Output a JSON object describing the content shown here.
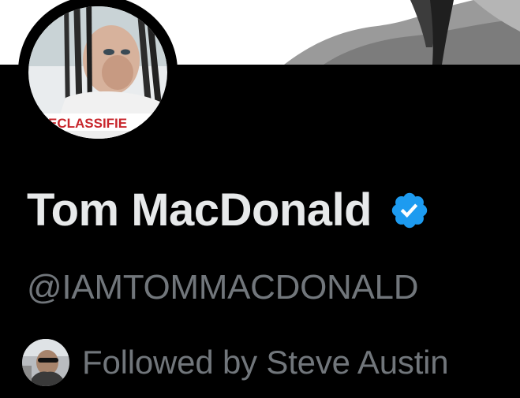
{
  "profile": {
    "display_name": "Tom MacDonald",
    "handle": "@IAMTOMMACDONALD",
    "verified": true,
    "avatar_label": "ECLASSIFIE",
    "followed_by_text": "Followed by Steve Austin"
  },
  "colors": {
    "background": "#000000",
    "name": "#e7e9ea",
    "secondary_text": "#71767b",
    "verified_blue": "#1d9bf0",
    "banner": "#ffffff"
  },
  "icons": {
    "verified": "verified-badge-icon"
  }
}
